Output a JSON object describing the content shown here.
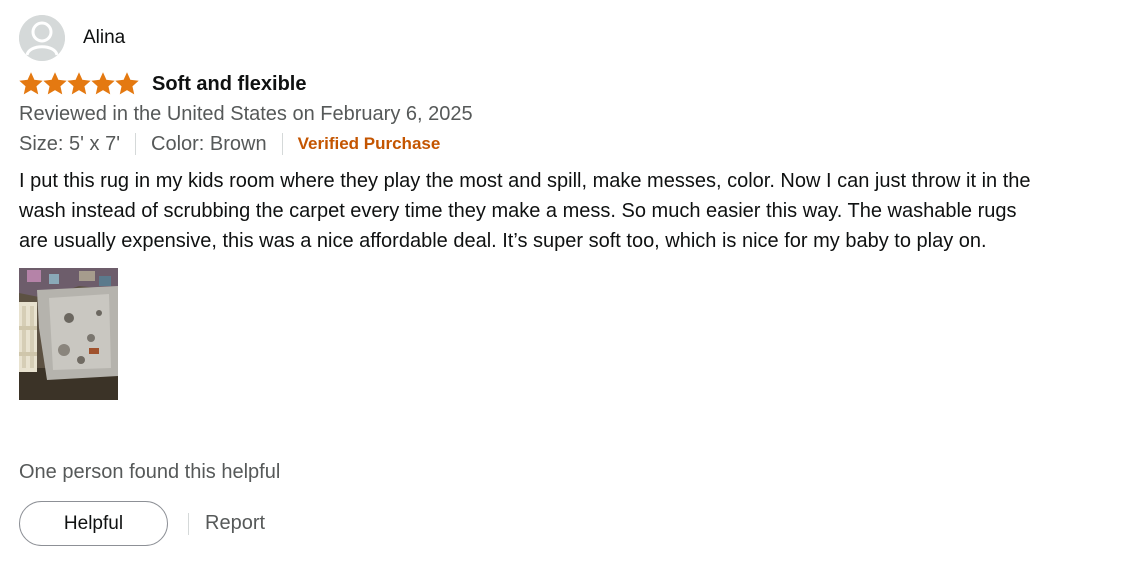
{
  "profile": {
    "name": "Alina",
    "avatar_icon": "user-silhouette-icon"
  },
  "review": {
    "rating": 5,
    "rating_max": 5,
    "star_color": "#e47911",
    "title": "Soft and flexible",
    "date_line": "Reviewed in the United States on February 6, 2025",
    "size": "Size: 5' x 7'",
    "color": "Color: Brown",
    "verified": "Verified Purchase",
    "verified_color": "#c45500",
    "body": "I put this rug in my kids room where they play the most and spill, make messes, color. Now I can just throw it in the wash instead of scrubbing the carpet every time they make a mess. So much easier this way. The washable rugs are usually expensive, this was a nice affordable deal. It’s super soft too, which is nice for my baby to play on."
  },
  "footer": {
    "helpful_count": "One person found this helpful",
    "helpful_button": "Helpful",
    "report_link": "Report"
  }
}
